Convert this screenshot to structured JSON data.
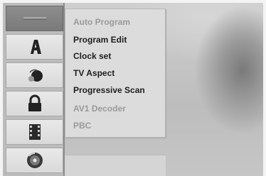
{
  "sidebar": {
    "items": [
      {
        "icon": "menu-lines-icon",
        "active": true
      },
      {
        "icon": "letter-a-icon",
        "active": false
      },
      {
        "icon": "globe-icon",
        "active": false
      },
      {
        "icon": "lock-icon",
        "active": false
      },
      {
        "icon": "film-icon",
        "active": false
      },
      {
        "icon": "disc-icon",
        "active": false
      }
    ]
  },
  "menu": {
    "items": [
      {
        "label": "Auto Program",
        "enabled": false
      },
      {
        "label": "Program Edit",
        "enabled": true
      },
      {
        "label": "Clock set",
        "enabled": true
      },
      {
        "label": "TV Aspect",
        "enabled": true
      },
      {
        "label": "Progressive Scan",
        "enabled": true
      },
      {
        "label": "AV1 Decoder",
        "enabled": false
      },
      {
        "label": "PBC",
        "enabled": false
      }
    ]
  }
}
